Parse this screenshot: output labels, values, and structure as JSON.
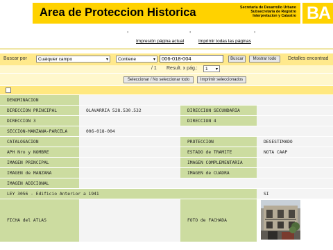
{
  "header": {
    "title": "Area de Proteccion Historica",
    "subtitle_lines": [
      "Secretaria de Desarrollo Urbano",
      "Subsecretaria de Registro",
      "Interpretacion y Catastro"
    ],
    "logo_text": "BA"
  },
  "links": {
    "print_current": "Impresión página actual",
    "print_all": "Imprimir todas las páginas"
  },
  "search": {
    "label": "Buscar por",
    "field_select": "Cualquier campo",
    "condition_select": "Contiene",
    "query_value": "006-018-004",
    "search_button": "Buscar",
    "show_all_button": "Mostrar todo",
    "details_text": "Detalles encontrad"
  },
  "pagination": {
    "page_of": "/ 1",
    "result_label": "Result. x pág.:",
    "per_page": "1"
  },
  "actions": {
    "select_toggle": "Seleccionar / No seleccionar todo",
    "print_selected": "Imprimir seleccionados"
  },
  "record": {
    "denominacion": "DENOMINACION",
    "direccion_principal_label": "DIRECCION PRINCIPAL",
    "direccion_principal_value": "OLAVARRIA 528.530.532",
    "direccion_secundaria_label": "DIRECCION SECUNDARIA",
    "direccion_3_label": "DIRECCION 3",
    "direccion_4_label": "DIRECCION 4",
    "smp_label": "SECCION-MANZANA-PARCELA",
    "smp_value": "006-018-004",
    "catalogacion_label": "CATALOGACION",
    "proteccion_label": "PROTECCION",
    "proteccion_value": "DESESTIMADO",
    "aph_label": "APH Nro y NOMBRE",
    "estado_label": "ESTADO de TRAMITE",
    "estado_value": "NOTA CAAP",
    "imagen_principal_label": "IMAGEN PRINCIPAL",
    "imagen_complementaria_label": "IMAGEN COMPLEMENTARIA",
    "imagen_manzana_label": "IMAGEN de MANZANA",
    "imagen_cuadra_label": "IMAGEN de CUADRA",
    "imagen_adicional_label": "IMAGEN ADICIONAL",
    "ley_label": "LEY 3056 - Edificio Anterior a 1941",
    "ley_value": "SI",
    "ficha_label": "FICHA del ATLAS",
    "foto_label": "FOTO de FACHADA"
  }
}
